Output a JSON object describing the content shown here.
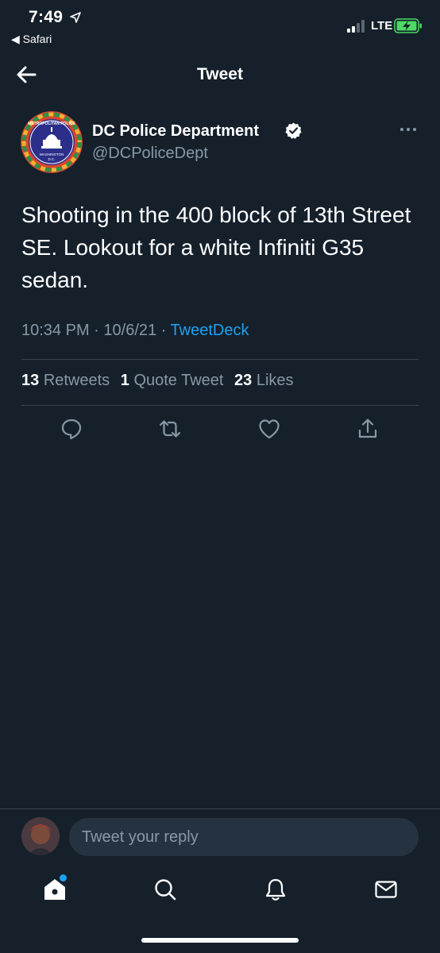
{
  "status_bar": {
    "time": "7:49",
    "back_app": "◀ Safari",
    "network": "LTE"
  },
  "header": {
    "title": "Tweet"
  },
  "tweet": {
    "author_name": "DC Police Department",
    "author_handle": "@DCPoliceDept",
    "avatar_text_top": "METROPOLITAN POLICE",
    "avatar_text_bottom": "WASHINGTON",
    "avatar_text_dc": "D.C.",
    "text": "Shooting in the 400 block of 13th Street SE. Lookout for a white Infiniti G35 sedan.",
    "time": "10:34 PM",
    "date": "10/6/21",
    "source": "TweetDeck",
    "separator": " · "
  },
  "stats": {
    "retweets_count": "13",
    "retweets_label": "Retweets",
    "quotes_count": "1",
    "quotes_label": "Quote Tweet",
    "likes_count": "23",
    "likes_label": "Likes"
  },
  "actions": [
    "reply-icon",
    "retweet-icon",
    "like-icon",
    "share-icon"
  ],
  "reply_bar": {
    "placeholder": "Tweet your reply"
  },
  "tab_bar": [
    "home-icon",
    "search-icon",
    "notifications-icon",
    "messages-icon"
  ],
  "colors": {
    "background": "#15202b",
    "accent": "#1da1f2",
    "secondary_text": "#8899a6",
    "divider": "#38444d"
  }
}
